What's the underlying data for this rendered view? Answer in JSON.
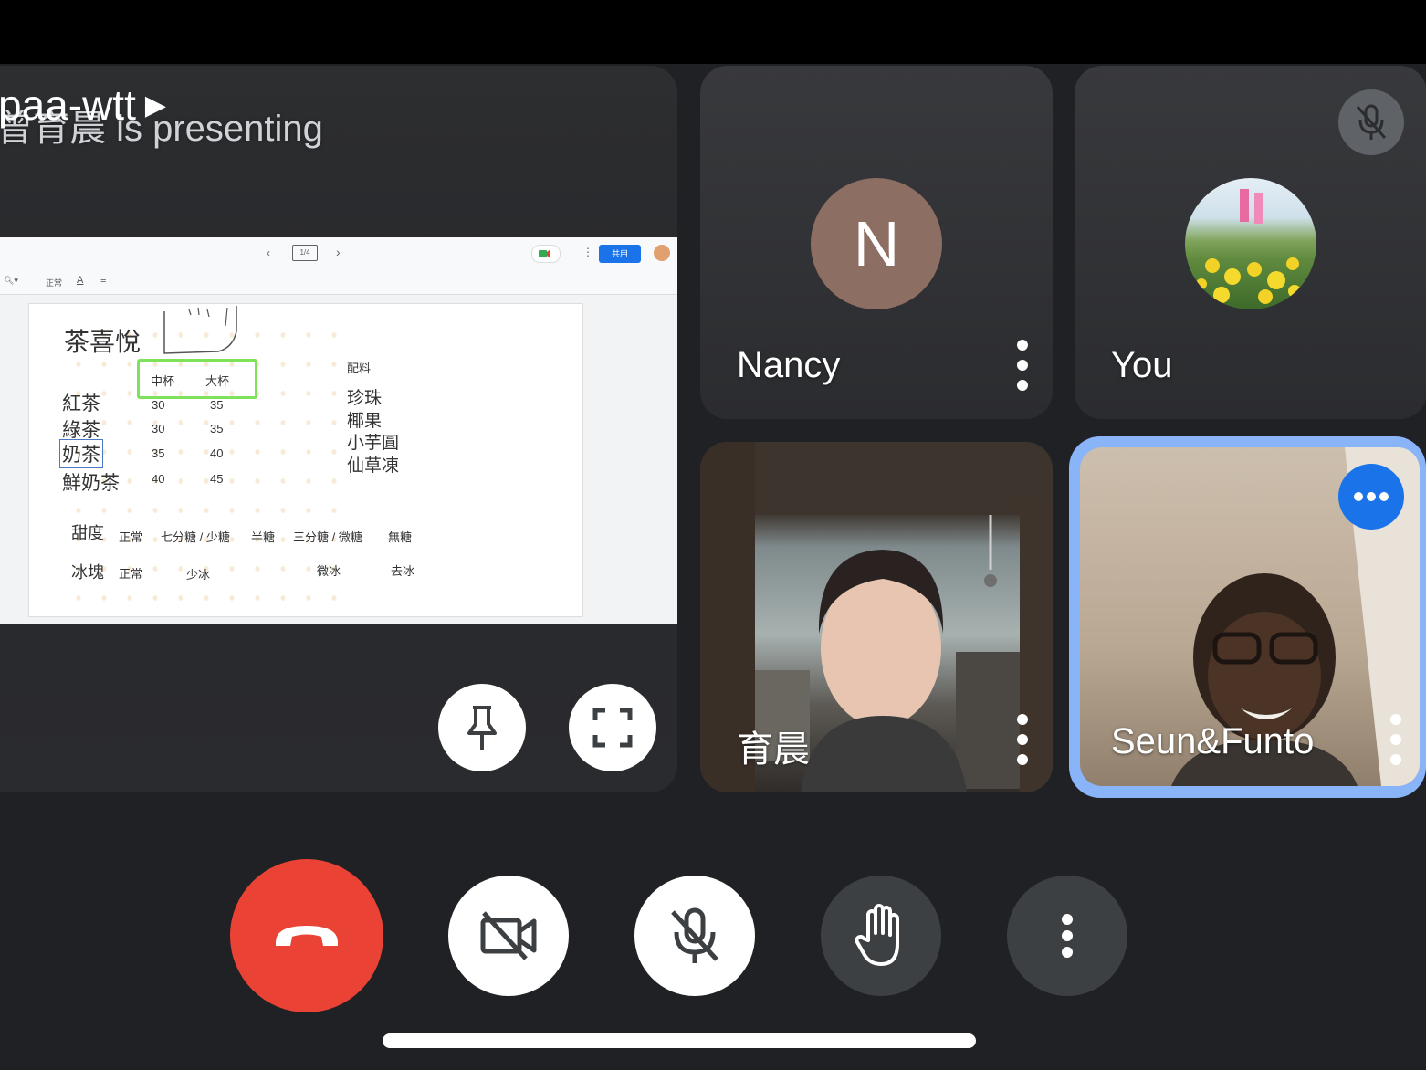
{
  "presentation": {
    "meeting_code": "paa-wtt",
    "presenter_label": "曾育晨 is presenting",
    "slide": {
      "toolbar_page": "1/4",
      "share_label": "共用",
      "format_text": "正常",
      "title": "茶喜悅",
      "size_headers": [
        "中杯",
        "大杯"
      ],
      "toppings_header": "配料",
      "drinks": [
        {
          "name": "紅茶",
          "medium": "30",
          "large": "35"
        },
        {
          "name": "綠茶",
          "medium": "30",
          "large": "35"
        },
        {
          "name": "奶茶",
          "medium": "35",
          "large": "40"
        },
        {
          "name": "鮮奶茶",
          "medium": "40",
          "large": "45"
        }
      ],
      "toppings": [
        "珍珠",
        "椰果",
        "小芋圓",
        "仙草凍"
      ],
      "sweetness_label": "甜度",
      "sweetness_options": [
        "正常",
        "七分糖 / 少糖",
        "半糖",
        "三分糖 / 微糖",
        "無糖"
      ],
      "ice_label": "冰塊",
      "ice_options": [
        "正常",
        "少冰",
        "微冰",
        "去冰"
      ]
    }
  },
  "participants": [
    {
      "name": "Nancy",
      "initial": "N",
      "avatar_color": "#8d6e63"
    },
    {
      "name": "You"
    },
    {
      "name": "育晨"
    },
    {
      "name": "Seun&Funto"
    }
  ],
  "colors": {
    "hangup": "#ea4335",
    "active_speaker": "#8ab4f8",
    "accent_blue": "#1a73e8"
  },
  "icons": {
    "pin": "pin-icon",
    "fullscreen": "fullscreen-icon",
    "muted_mic": "mic-off-icon",
    "camera_off": "videocam-off-icon",
    "raise_hand": "hand-icon",
    "hangup": "call-end-icon",
    "more": "more-vert-icon"
  }
}
